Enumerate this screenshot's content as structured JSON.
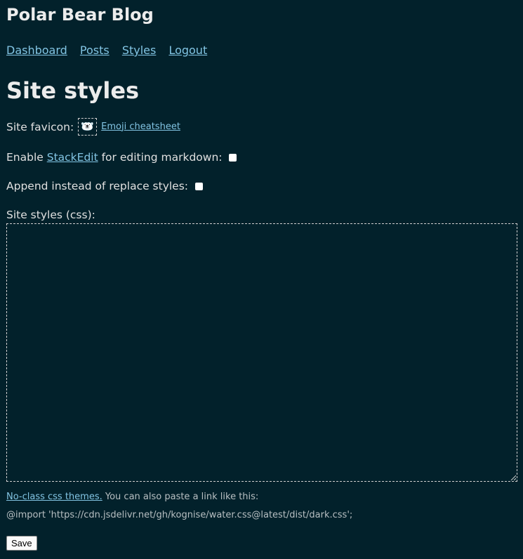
{
  "header": {
    "site_title": "Polar Bear Blog"
  },
  "nav": [
    {
      "label": "Dashboard"
    },
    {
      "label": "Posts"
    },
    {
      "label": "Styles"
    },
    {
      "label": "Logout"
    }
  ],
  "page": {
    "title": "Site styles"
  },
  "form": {
    "favicon_label": "Site favicon:",
    "favicon_value": "🐻‍❄️",
    "emoji_link": "Emoji cheatsheet",
    "stackedit_prefix": "Enable ",
    "stackedit_link": "StackEdit",
    "stackedit_suffix": " for editing markdown:",
    "stackedit_checked": false,
    "append_label": "Append instead of replace styles:",
    "append_checked": false,
    "css_label": "Site styles (css):",
    "css_value": "",
    "themes_link": "No-class css themes.",
    "hint_text": " You can also paste a link like this:",
    "import_example": "@import 'https://cdn.jsdelivr.net/gh/kognise/water.css@latest/dist/dark.css';",
    "save_label": "Save"
  }
}
